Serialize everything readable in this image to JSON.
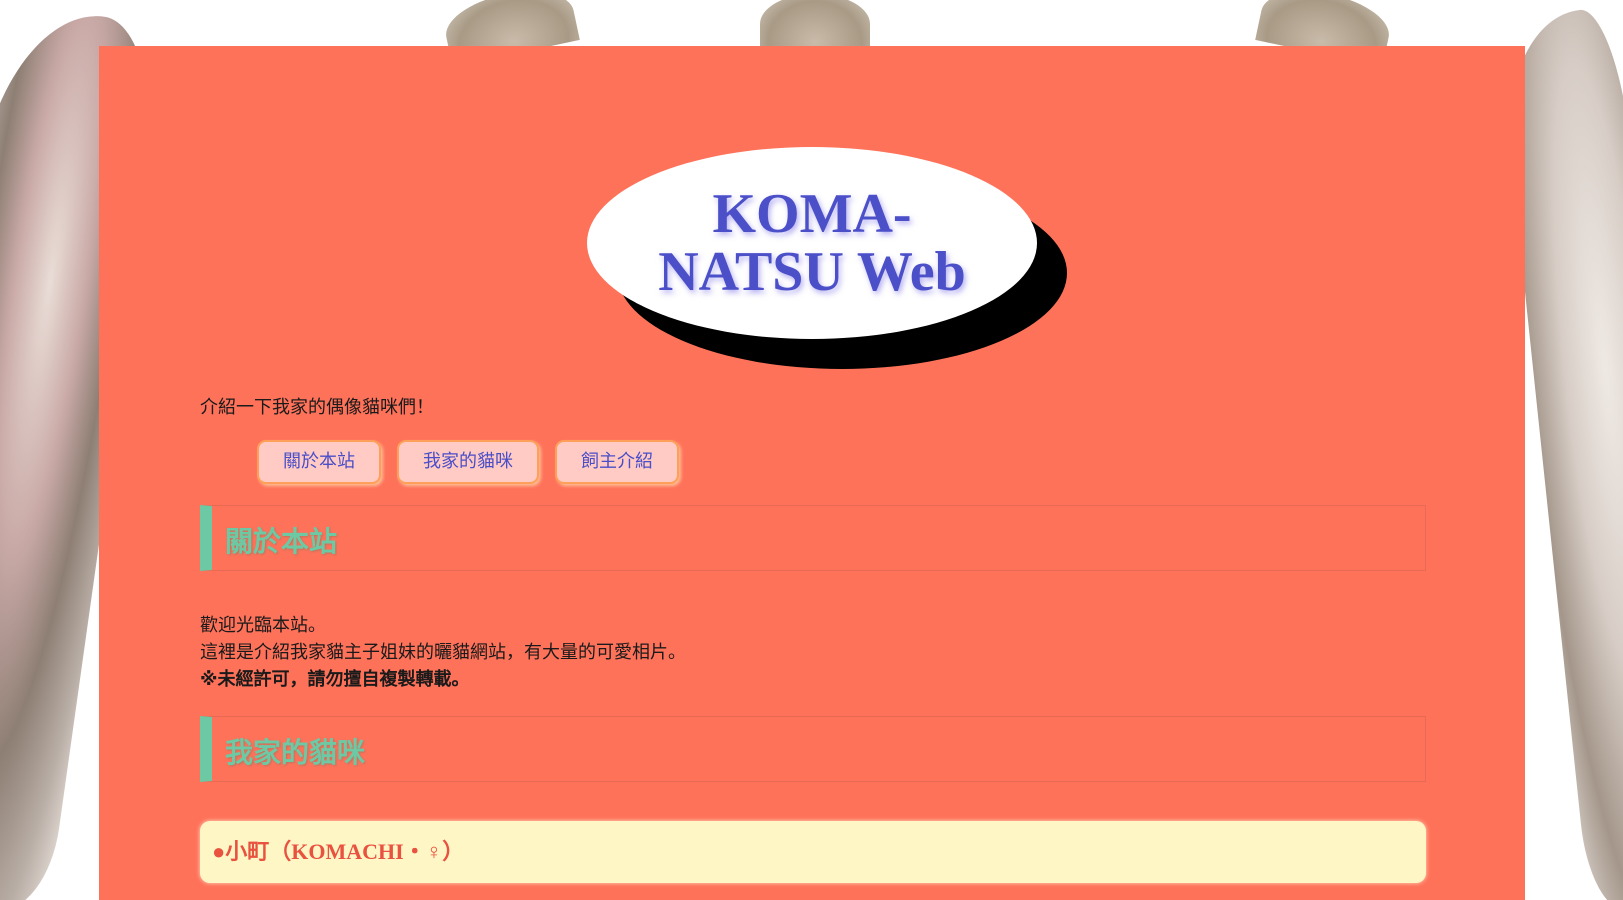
{
  "logo": {
    "text": "KOMA-\nNATSU Web"
  },
  "intro": "介紹一下我家的偶像貓咪們！",
  "nav": {
    "about": "關於本站",
    "cats": "我家的貓咪",
    "owner": "飼主介紹"
  },
  "sections": {
    "about": {
      "title": "關於本站",
      "line1": "歡迎光臨本站。",
      "line2": "這裡是介紹我家貓主子姐妹的曬貓網站，有大量的可愛相片。",
      "line3": "※未經許可，請勿擅自複製轉載。"
    },
    "cats": {
      "title": "我家的貓咪",
      "items": [
        {
          "label": "●小町（KOMACHI・♀）"
        }
      ]
    }
  },
  "colors": {
    "panel": "#ff725a",
    "accent": "#6dc9a4",
    "logo_text": "#4b4fc8",
    "nav_bg": "#ffcbc4",
    "nav_border": "#ffa05a",
    "cat_item_bg": "#fff6c6",
    "cat_item_text": "#e8523f"
  }
}
